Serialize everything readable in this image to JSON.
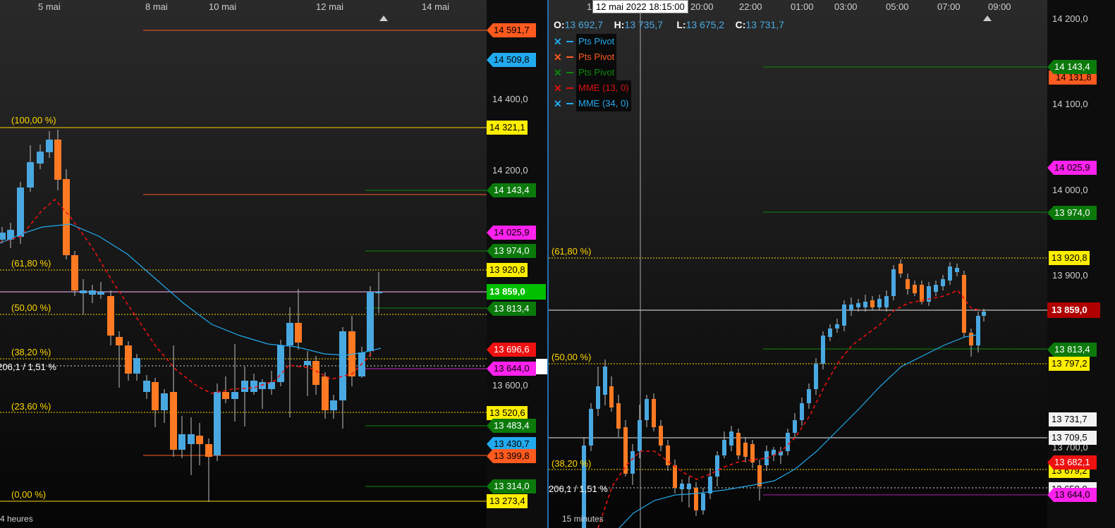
{
  "left": {
    "timeframe": "4 heures",
    "dates": [
      "5 mai",
      "8 mai",
      "10 mai",
      "12 mai",
      "14 mai"
    ],
    "axis_ticks": [
      "14 400,0",
      "14 200,0",
      "13 600,0"
    ],
    "fib_labels": [
      "(100,00 %)",
      "(61,80 %)",
      "(50,00 %)",
      "(38,20 %)",
      "(23,60 %)",
      "(0,00 %)"
    ],
    "ratio": "206,1 / 1,51 %",
    "tags": [
      {
        "text": "14 591,7",
        "bg": "#ff5a1f",
        "fg": "#000"
      },
      {
        "text": "14 509,8",
        "bg": "#22aaee",
        "fg": "#000"
      },
      {
        "text": "14 321,1",
        "bg": "#ffee00",
        "fg": "#000"
      },
      {
        "text": "14 143,4",
        "bg": "#0b7a0b",
        "fg": "#fff"
      },
      {
        "text": "14 025,9",
        "bg": "#ff22ee",
        "fg": "#000"
      },
      {
        "text": "13 974,0",
        "bg": "#0b7a0b",
        "fg": "#fff"
      },
      {
        "text": "13 920,8",
        "bg": "#ffee00",
        "fg": "#000"
      },
      {
        "text": "13 859,0",
        "bg": "#00c000",
        "fg": "#fff"
      },
      {
        "text": "13 813,4",
        "bg": "#0b7a0b",
        "fg": "#fff"
      },
      {
        "text": "13 696,6",
        "bg": "#ee1111",
        "fg": "#fff"
      },
      {
        "text": "13 644,0",
        "bg": "#ff22ee",
        "fg": "#000"
      },
      {
        "text": "13 520,6",
        "bg": "#ffee00",
        "fg": "#000"
      },
      {
        "text": "13 483,4",
        "bg": "#0b7a0b",
        "fg": "#fff"
      },
      {
        "text": "13 430,7",
        "bg": "#22aaee",
        "fg": "#000"
      },
      {
        "text": "13 399,8",
        "bg": "#ff5a1f",
        "fg": "#000"
      },
      {
        "text": "13 314,0",
        "bg": "#0b7a0b",
        "fg": "#fff"
      },
      {
        "text": "13 273,4",
        "bg": "#ffee00",
        "fg": "#000"
      }
    ]
  },
  "right": {
    "timeframe": "15 minutes",
    "times": [
      "20:00",
      "22:00",
      "01:00",
      "03:00",
      "05:00",
      "07:00",
      "09:00"
    ],
    "tooltip": "12 mai 2022 18:15:00",
    "ohlc": {
      "o_label": "O:",
      "o": "13 692,7",
      "h_label": "H:",
      "h": "13 735,7",
      "l_label": "L:",
      "l": "13 675,2",
      "c_label": "C:",
      "c": "13 731,7"
    },
    "legend": [
      {
        "x": "✕",
        "name": "Pts Pivot",
        "color": "#22aaee"
      },
      {
        "x": "✕",
        "name": "Pts Pivot",
        "color": "#ff5a1f"
      },
      {
        "x": "✕",
        "name": "Pts Pivot",
        "color": "#0b8a0b"
      },
      {
        "x": "✕",
        "name": "MME (13, 0)",
        "color": "#dd1111"
      },
      {
        "x": "✕",
        "name": "MME (34, 0)",
        "color": "#22aaee"
      }
    ],
    "axis_ticks": [
      "14 200,0",
      "14 100,0",
      "14 000,0",
      "13 900,0",
      "13 700,0"
    ],
    "fib_labels": [
      "(61,80 %)",
      "(50,00 %)",
      "(38,20 %)"
    ],
    "ratio": "206,1 / 1,51 %",
    "tags": [
      {
        "text": "14 143,4",
        "bg": "#0b7a0b",
        "fg": "#fff"
      },
      {
        "text": "14 131,8",
        "bg": "#ff5a1f",
        "fg": "#000"
      },
      {
        "text": "14 025,9",
        "bg": "#ff22ee",
        "fg": "#000"
      },
      {
        "text": "13 974,0",
        "bg": "#0b7a0b",
        "fg": "#fff"
      },
      {
        "text": "13 920,8",
        "bg": "#ffee00",
        "fg": "#000"
      },
      {
        "text": "13 859,0",
        "bg": "#b00000",
        "fg": "#fff"
      },
      {
        "text": "13 813,4",
        "bg": "#0b7a0b",
        "fg": "#fff"
      },
      {
        "text": "13 797,2",
        "bg": "#ffee00",
        "fg": "#000"
      },
      {
        "text": "13 731,7",
        "bg": "#f2f2f2",
        "fg": "#000"
      },
      {
        "text": "13 709,5",
        "bg": "#f2f2f2",
        "fg": "#000"
      },
      {
        "text": "13 682,1",
        "bg": "#ee1111",
        "fg": "#fff"
      },
      {
        "text": "13 679,2",
        "bg": "#ffee00",
        "fg": "#000"
      },
      {
        "text": "13 658,0",
        "bg": "#f2f2f2",
        "fg": "#000"
      },
      {
        "text": "13 644,0",
        "bg": "#ff22ee",
        "fg": "#000"
      }
    ]
  }
}
